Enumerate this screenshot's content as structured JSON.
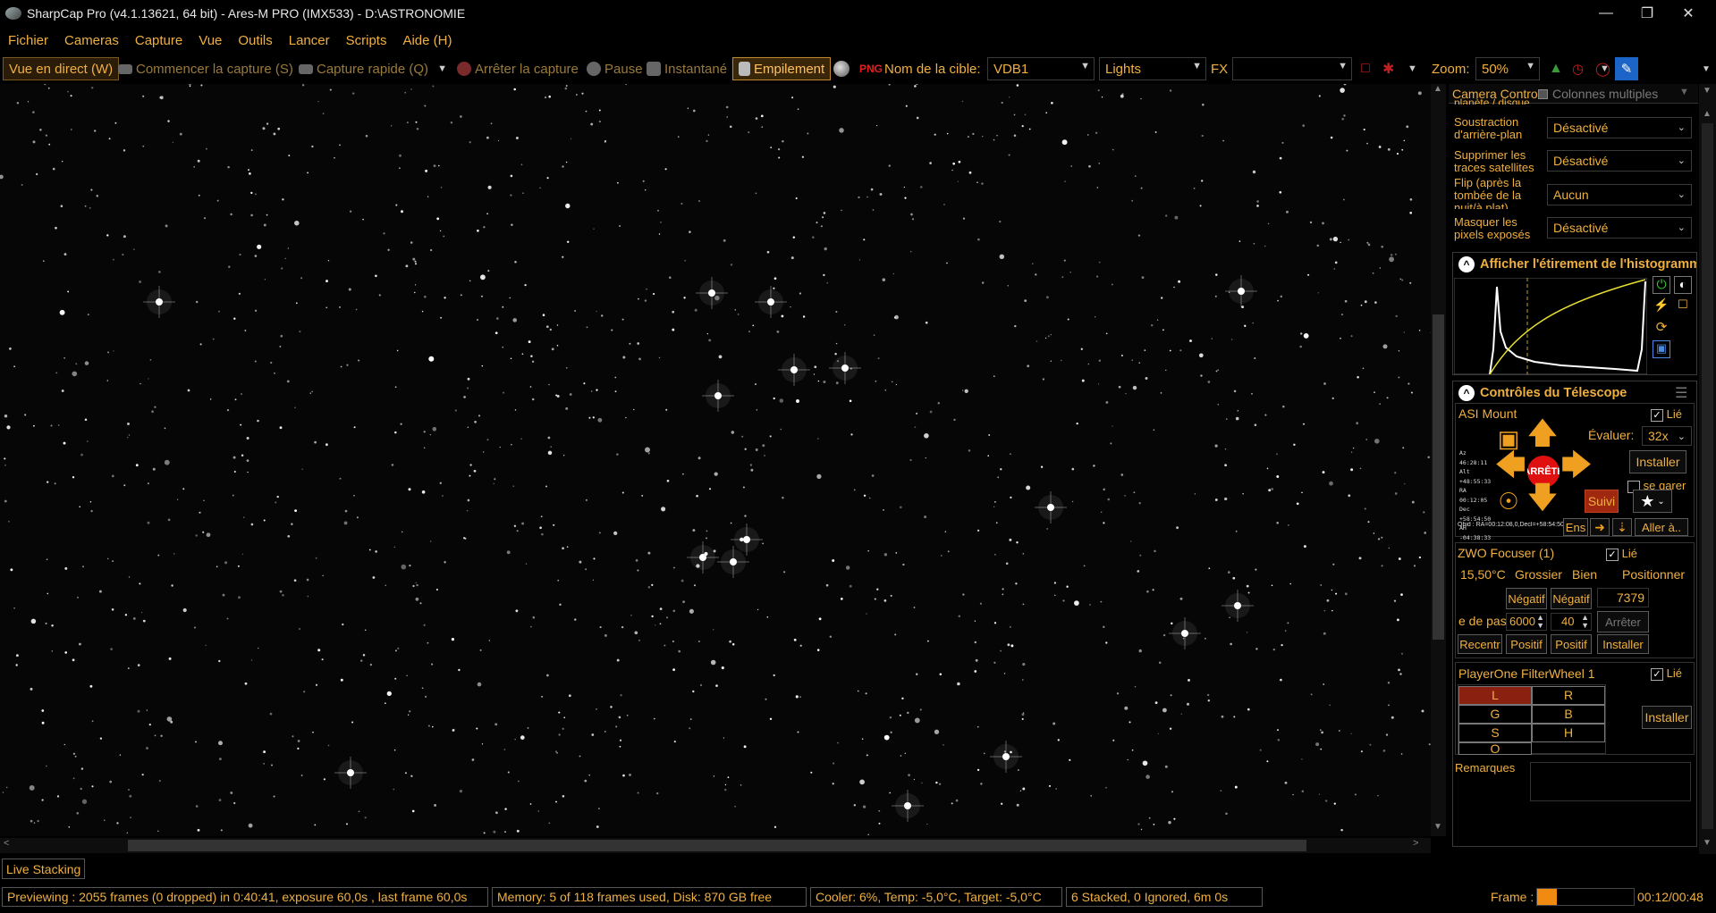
{
  "window": {
    "title": "SharpCap Pro (v4.1.13621, 64 bit) - Ares-M PRO (IMX533) - D:\\ASTRONOMIE"
  },
  "menu": [
    "Fichier",
    "Cameras",
    "Capture",
    "Vue",
    "Outils",
    "Lancer",
    "Scripts",
    "Aide (H)"
  ],
  "toolbar": {
    "live": "Vue en direct (W)",
    "start_capture": "Commencer la capture (S)",
    "quick_capture": "Capture rapide (Q)",
    "stop_capture": "Arrêter la capture",
    "pause": "Pause",
    "snapshot": "Instantané",
    "stacking": "Empilement",
    "target_label": "Nom de la cible:",
    "target_value": "VDB1",
    "frame_type": "Lights",
    "fx_label": "FX",
    "fx_value": "",
    "zoom_label": "Zoom:",
    "zoom_value": "50%"
  },
  "panel": {
    "tabs": {
      "camera_controls": "Camera Controls",
      "multi_columns": "Colonnes multiples"
    },
    "partial_label": "planète / disque",
    "settings": [
      {
        "label": "Soustraction d'arrière-plan",
        "value": "Désactivé"
      },
      {
        "label": "Supprimer les traces satellites",
        "value": "Désactivé"
      },
      {
        "label": "Flip (après la tombée de la nuit/à plat)",
        "value": "Aucun"
      },
      {
        "label": "Masquer les pixels exposés",
        "value": "Désactivé"
      }
    ],
    "histogram": {
      "title": "Afficher l'étirement de l'histogramme",
      "toggle": "^"
    },
    "telescope": {
      "title": "Contrôles du Télescope",
      "toggle": "^",
      "mount_name": "ASI Mount",
      "linked": "Lié",
      "evaluate_label": "Évaluer:",
      "rate": "32x",
      "install": "Installer",
      "stop": "ARRÊTE",
      "park": "se garer",
      "tracking": "Suivi",
      "set": "Ens",
      "goto": "Aller à..",
      "coords": [
        "Az 46:28:11",
        "Alt +48:55:33",
        "RA 00:12:05",
        "Dec +58:54:50",
        "AH -04:38:33"
      ],
      "target_line": "Obid : RA=00:12:08,0,Decl=+58:54:50"
    },
    "focuser": {
      "name": "ZWO Focuser (1)",
      "linked": "Lié",
      "temp": "15,50°C",
      "coarse": "Grossier",
      "fine": "Bien",
      "position": "Positionner",
      "negative": "Négatif",
      "positive": "Positif",
      "position_value": "7379",
      "step_label": "e de pas",
      "coarse_step": "6000",
      "fine_step": "40",
      "stop": "Arrêter",
      "recenter": "Recentr",
      "install": "Installer"
    },
    "filterwheel": {
      "name": "PlayerOne FilterWheel 1",
      "linked": "Lié",
      "filters": [
        "L",
        "R",
        "G",
        "B",
        "S",
        "H",
        "O"
      ],
      "active": "L",
      "install": "Installer"
    },
    "notes_label": "Remarques"
  },
  "status": {
    "live_stacking": "Live Stacking",
    "preview": "Previewing : 2055 frames (0 dropped) in 0:40:41, exposure 60,0s , last frame 60,0s",
    "memory": "Memory: 5 of 118 frames used, Disk: 870 GB free",
    "cooler": "Cooler: 6%, Temp: -5,0°C, Target: -5,0°C",
    "stacked": "6 Stacked, 0 Ignored, 6m 0s",
    "frame_label": "Frame :",
    "frame_progress": 0.2,
    "time": "00:12/00:48"
  },
  "colors": {
    "accent": "#f0b040",
    "active_filter": "#8a2010",
    "stop_red": "#e01010"
  },
  "icons": [
    "app-icon",
    "minimize-icon",
    "maximize-icon",
    "close-icon",
    "camera-icon",
    "record-icon",
    "pause-icon",
    "snapshot-icon",
    "stack-icon",
    "chevron-down-icon",
    "arrow-up-icon",
    "arrow-down-icon",
    "arrow-left-icon",
    "arrow-right-icon",
    "star-icon",
    "checkbox-icon",
    "histogram-icon"
  ]
}
